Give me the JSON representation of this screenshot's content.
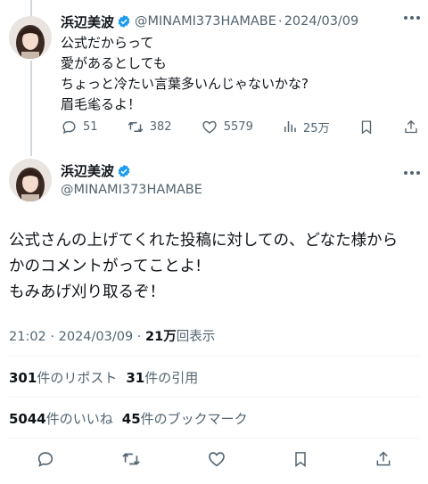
{
  "reply": {
    "author_name": "浜辺美波",
    "handle": "@MINAMI373HAMABE",
    "separator": "·",
    "date": "2024/03/09",
    "lines": [
      "公式だからって",
      "愛があるとしても",
      "ちょっと冷たい言葉多いんじゃないかな?",
      "眉毛毟るよ！"
    ],
    "actions": {
      "replies": "51",
      "reposts": "382",
      "likes": "5579",
      "views": "25万"
    }
  },
  "main": {
    "author_name": "浜辺美波",
    "handle": "@MINAMI373HAMABE",
    "lines": [
      "公式さんの上げてくれた投稿に対しての、どなた様から",
      "かのコメントがってことよ!",
      "もみあげ刈り取るぞ！"
    ],
    "time": "21:02 · 2024/03/09 · ",
    "views_count": "21万",
    "views_label": "回表示",
    "reposts_count": "301",
    "reposts_label": "件のリポスト",
    "quotes_count": "31",
    "quotes_label": "件の引用",
    "likes_count": "5044",
    "likes_label": "件のいいね",
    "bookmarks_count": "45",
    "bookmarks_label": "件のブックマーク"
  },
  "icons": [
    "verified-badge-icon",
    "more-icon",
    "reply-icon",
    "repost-icon",
    "like-icon",
    "views-icon",
    "bookmark-icon",
    "share-icon"
  ],
  "colors": {
    "verified": "#1d9bf0",
    "text": "#0f1419",
    "secondary": "#536471",
    "divider": "#eff3f4"
  }
}
